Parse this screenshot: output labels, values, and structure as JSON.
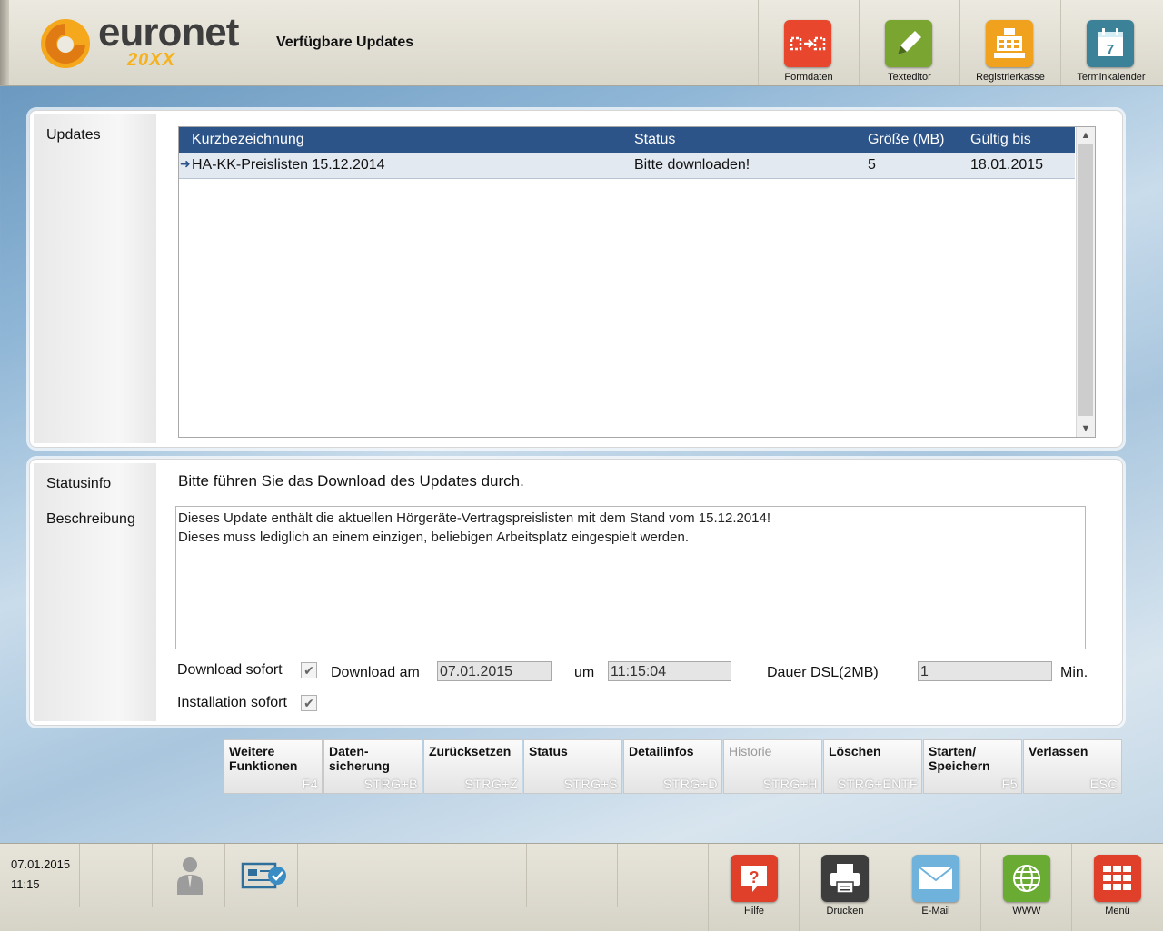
{
  "header": {
    "brand": "euronet",
    "brand_sub": "20XX",
    "title": "Verfügbare Updates",
    "buttons": [
      {
        "label": "Formdaten",
        "icon": "form-data-icon",
        "color": "#e8472d"
      },
      {
        "label": "Texteditor",
        "icon": "pencil-icon",
        "color": "#7aa531"
      },
      {
        "label": "Registrierkasse",
        "icon": "cash-register-icon",
        "color": "#f0a21e"
      },
      {
        "label": "Terminkalender",
        "icon": "calendar-icon",
        "color": "#3b8299",
        "day": "7"
      }
    ]
  },
  "updates": {
    "label": "Updates",
    "columns": [
      "Kurzbezeichnung",
      "Status",
      "Größe (MB)",
      "Gültig bis"
    ],
    "rows": [
      {
        "name": "HA-KK-Preislisten 15.12.2014",
        "status": "Bitte downloaden!",
        "size": "5",
        "valid_until": "18.01.2015"
      }
    ],
    "header_color": "#2d5488"
  },
  "statusinfo": {
    "label": "Statusinfo",
    "text": "Bitte führen Sie das Download des Updates durch.",
    "desc_label": "Beschreibung",
    "desc_line1": "Dieses Update enthält die aktuellen Hörgeräte-Vertragspreislisten mit dem Stand vom 15.12.2014!",
    "desc_line2": "Dieses muss lediglich an einem einzigen, beliebigen Arbeitsplatz eingespielt werden.",
    "download_now_label": "Download sofort",
    "download_at_label": "Download am",
    "download_date": "07.01.2015",
    "um_label": "um",
    "download_time": "11:15:04",
    "duration_label": "Dauer DSL(2MB)",
    "duration_value": "1",
    "duration_unit": "Min.",
    "install_now_label": "Installation sofort"
  },
  "functions": [
    {
      "l1": "Weitere",
      "l2": "Funktionen",
      "key": "F4"
    },
    {
      "l1": "Daten-",
      "l2": "sicherung",
      "key": "STRG+B"
    },
    {
      "l1": "Zurücksetzen",
      "l2": "",
      "key": "STRG+Z"
    },
    {
      "l1": "Status",
      "l2": "",
      "key": "STRG+S"
    },
    {
      "l1": "Detailinfos",
      "l2": "",
      "key": "STRG+D"
    },
    {
      "l1": "Historie",
      "l2": "",
      "key": "STRG+H"
    },
    {
      "l1": "Löschen",
      "l2": "",
      "key": "STRG+ENTF"
    },
    {
      "l1": "Starten/",
      "l2": "Speichern",
      "key": "F5"
    },
    {
      "l1": "Verlassen",
      "l2": "",
      "key": "ESC"
    }
  ],
  "footer": {
    "date": "07.01.2015",
    "time": "11:15",
    "buttons": [
      {
        "label": "Hilfe",
        "icon": "help-icon",
        "color": "#e0402a"
      },
      {
        "label": "Drucken",
        "icon": "printer-icon",
        "color": "#3d3d3d"
      },
      {
        "label": "E-Mail",
        "icon": "mail-icon",
        "color": "#6fb2dc"
      },
      {
        "label": "WWW",
        "icon": "globe-icon",
        "color": "#6aab33"
      },
      {
        "label": "Menü",
        "icon": "menu-grid-icon",
        "color": "#e0402a"
      }
    ]
  }
}
